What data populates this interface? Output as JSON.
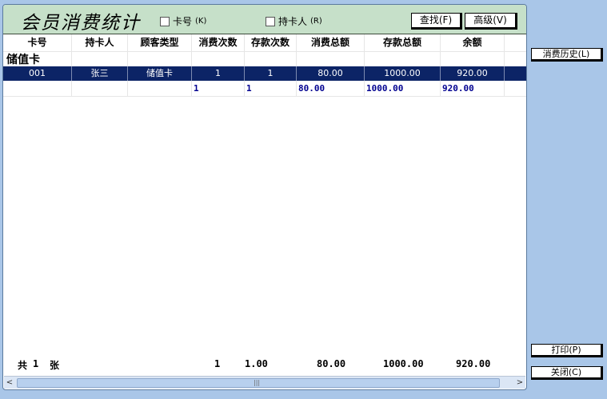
{
  "title": "会员消费统计",
  "filters": {
    "card_no": {
      "label": "卡号",
      "hotkey": "(K)",
      "checked": false
    },
    "holder": {
      "label": "持卡人",
      "hotkey": "(R)",
      "checked": false
    }
  },
  "toolbar": {
    "search": "查找(F)",
    "advanced": "高级(V)"
  },
  "columns": [
    "卡号",
    "持卡人",
    "顾客类型",
    "消费次数",
    "存款次数",
    "消费总额",
    "存款总额",
    "余额"
  ],
  "group_label": "储值卡",
  "rows": [
    [
      "001",
      "张三",
      "储值卡",
      "1",
      "1",
      "80.00",
      "1000.00",
      "920.00"
    ]
  ],
  "subtotal": [
    "",
    "",
    "",
    "1",
    "1",
    "80.00",
    "1000.00",
    "920.00"
  ],
  "footer": {
    "prefix": "共",
    "count": "1",
    "unit": "张",
    "consume_count": "1",
    "deposit_count": "1.00",
    "consume_total": "80.00",
    "deposit_total": "1000.00",
    "balance": "920.00"
  },
  "side_buttons": {
    "history": "消费历史(L)",
    "print": "打印(P)",
    "close": "关闭(C)"
  },
  "scrollbar": {
    "left_arrow": "<",
    "right_arrow": ">",
    "grip": "|||"
  }
}
